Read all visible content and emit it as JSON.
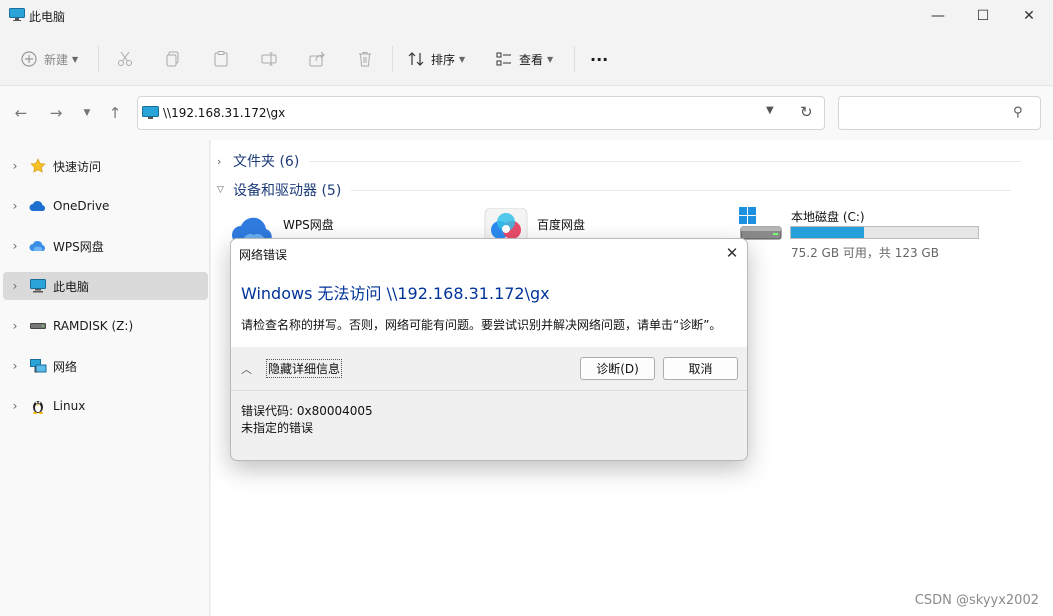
{
  "window": {
    "title": "此电脑",
    "minimize_glyph": "—",
    "maximize_glyph": "☐",
    "close_glyph": "✕"
  },
  "commandbar": {
    "new_label": "新建",
    "sort_label": "排序",
    "view_label": "查看",
    "more_glyph": "···"
  },
  "address": {
    "path": "\\\\192.168.31.172\\gx",
    "search_placeholder": ""
  },
  "sidebar": {
    "items": [
      {
        "label": "快速访问",
        "icon": "star-icon"
      },
      {
        "label": "OneDrive",
        "icon": "cloud-icon"
      },
      {
        "label": "WPS网盘",
        "icon": "wps-cloud-icon"
      },
      {
        "label": "此电脑",
        "icon": "computer-icon",
        "selected": true
      },
      {
        "label": "RAMDISK (Z:)",
        "icon": "drive-icon"
      },
      {
        "label": "网络",
        "icon": "network-icon"
      },
      {
        "label": "Linux",
        "icon": "penguin-icon"
      }
    ]
  },
  "content": {
    "folders_group": "文件夹 (6)",
    "devices_group": "设备和驱动器 (5)",
    "tiles": [
      {
        "name": "WPS网盘",
        "icon": "wps-cloud-icon"
      },
      {
        "name": "百度网盘",
        "icon": "baidu-netdisk-icon"
      },
      {
        "name": "本地磁盘 (C:)",
        "icon": "windows-drive-icon",
        "usage": "75.2 GB 可用，共 123 GB",
        "used_fraction": 0.39
      }
    ]
  },
  "dialog": {
    "title": "网络错误",
    "heading": "Windows 无法访问 \\\\192.168.31.172\\gx",
    "message": "请检查名称的拼写。否则，网络可能有问题。要尝试识别并解决网络问题，请单击“诊断”。",
    "toggle_label": "隐藏详细信息",
    "diagnose_label": "诊断(D)",
    "cancel_label": "取消",
    "error_code": "错误代码: 0x80004005",
    "error_detail": "未指定的错误"
  },
  "watermark": "CSDN @skyyx2002",
  "colors": {
    "accent": "#26a0da",
    "dialog_heading": "#003399",
    "group_heading": "#1d3c78"
  }
}
